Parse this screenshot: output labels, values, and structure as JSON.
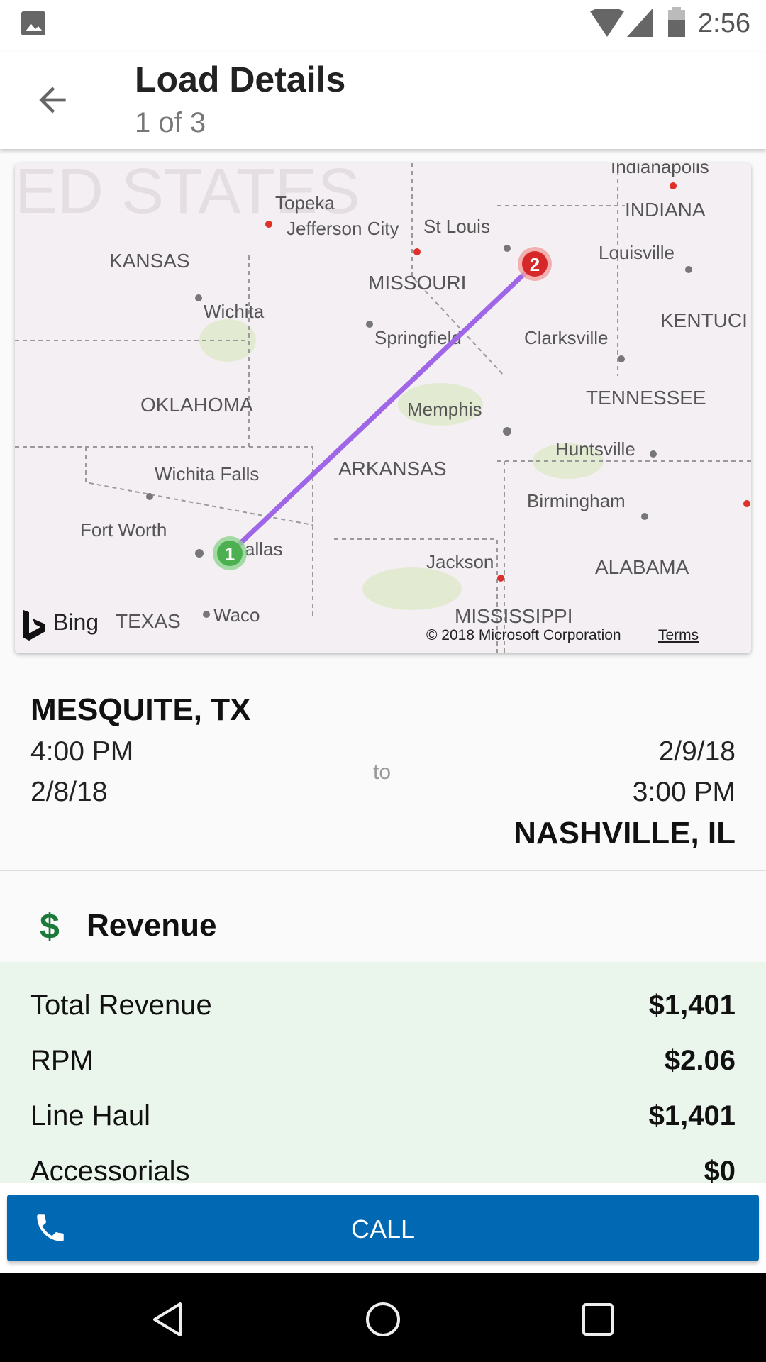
{
  "status_bar": {
    "time": "2:56",
    "icons": [
      "image-notification-icon",
      "wifi-icon",
      "signal-icon",
      "battery-icon"
    ]
  },
  "app_bar": {
    "title": "Load Details",
    "subtitle": "1 of 3",
    "back_icon": "arrow-back-icon"
  },
  "map": {
    "labels": {
      "topeka": "Topeka",
      "jefferson": "Jefferson City",
      "stlouis": "St Louis",
      "indianapolis": "Indianapolis",
      "indiana": "INDIANA",
      "kansas": "KANSAS",
      "missouri": "MISSOURI",
      "louisville": "Louisville",
      "wichita": "Wichita",
      "springfield": "Springfield",
      "clarksville": "Clarksville",
      "kentucky": "KENTUCI",
      "oklahoma": "OKLAHOMA",
      "memphis": "Memphis",
      "tennessee": "TENNESSEE",
      "huntsville": "Huntsville",
      "wichitafalls": "Wichita Falls",
      "arkansas": "ARKANSAS",
      "birmingham": "Birmingham",
      "fortworth": "Fort Worth",
      "dallas": "allas",
      "jackson": "Jackson",
      "alabama": "ALABAMA",
      "texas": "TEXAS",
      "waco": "Waco",
      "mississippi": "MISSISSIPPI",
      "states": "ED STATES"
    },
    "pin_start": "1",
    "pin_end": "2",
    "brand": "Bing",
    "copyright": "© 2018 Microsoft Corporation",
    "terms": "Terms",
    "route_color": "#a066e8"
  },
  "route": {
    "origin": "MESQUITE, TX",
    "origin_time": "4:00 PM",
    "origin_date": "2/8/18",
    "to": "to",
    "dest_date": "2/9/18",
    "dest_time": "3:00 PM",
    "destination": "NASHVILLE, IL"
  },
  "revenue": {
    "icon": "$",
    "title": "Revenue",
    "rows": [
      {
        "label": "Total Revenue",
        "value": "$1,401"
      },
      {
        "label": "RPM",
        "value": "$2.06"
      },
      {
        "label": "Line Haul",
        "value": "$1,401"
      },
      {
        "label": "Accessorials",
        "value": "$0"
      }
    ]
  },
  "call_button": {
    "label": "CALL",
    "color": "#0168b3"
  },
  "nav_bar": {
    "icons": [
      "back-triangle-icon",
      "home-circle-icon",
      "recents-square-icon"
    ]
  }
}
